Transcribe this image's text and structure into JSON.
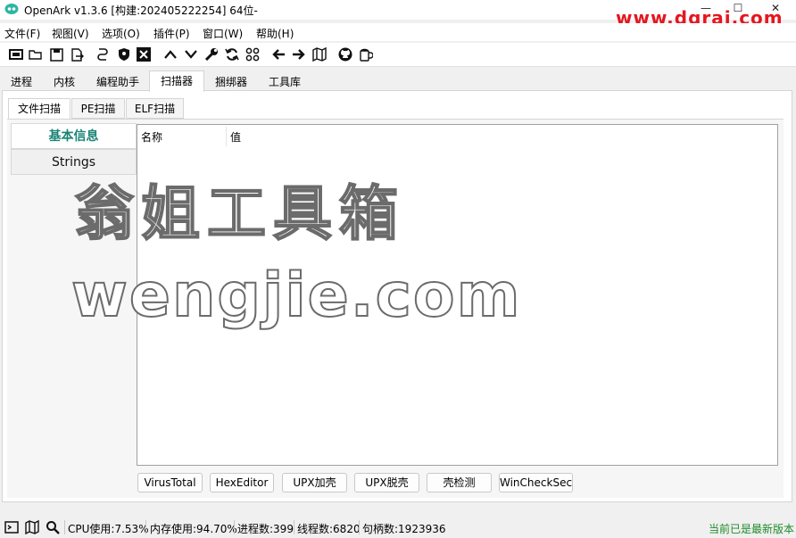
{
  "window": {
    "title": "OpenArk v1.3.6 [构建:202405222254]  64位-",
    "controls": [
      "—",
      "☐",
      "✕"
    ]
  },
  "watermark_top": "www.dgrai.com",
  "menu": [
    "文件(F)",
    "视图(V)",
    "选项(O)",
    "插件(P)",
    "窗口(W)",
    "帮助(H)"
  ],
  "toolbar_icons": [
    "console-icon",
    "open-folder-icon",
    "save-icon",
    "export-icon",
    "link-icon",
    "shield-icon",
    "kill-icon",
    "up-icon",
    "down-icon",
    "wrench-icon",
    "refresh-icon",
    "grid-icon",
    "back-icon",
    "forward-icon",
    "map-icon",
    "github-icon",
    "beer-icon"
  ],
  "main_tabs": [
    "进程",
    "内核",
    "编程助手",
    "扫描器",
    "捆绑器",
    "工具库"
  ],
  "active_main_tab": "扫描器",
  "sub_tabs": [
    "文件扫描",
    "PE扫描",
    "ELF扫描"
  ],
  "active_sub_tab": "文件扫描",
  "side_list": [
    "基本信息",
    "Strings"
  ],
  "table": {
    "columns": [
      "名称",
      "值"
    ],
    "rows": []
  },
  "buttons": [
    "VirusTotal",
    "HexEditor",
    "UPX加壳",
    "UPX脱壳",
    "壳检测",
    "WinCheckSec"
  ],
  "overlay_watermark": {
    "line1": "翁姐工具箱",
    "line2": "wengjie.com"
  },
  "status": {
    "cpu": "CPU使用:7.53%",
    "mem": "内存使用:94.70%",
    "procs": "进程数:399",
    "threads": "线程数:6820",
    "handles": "句柄数:1923936",
    "update": "当前已是最新版本"
  },
  "colors": {
    "accent": "#1a8476",
    "watermark_red": "#e5171f",
    "update_green": "#1f8a2a"
  }
}
